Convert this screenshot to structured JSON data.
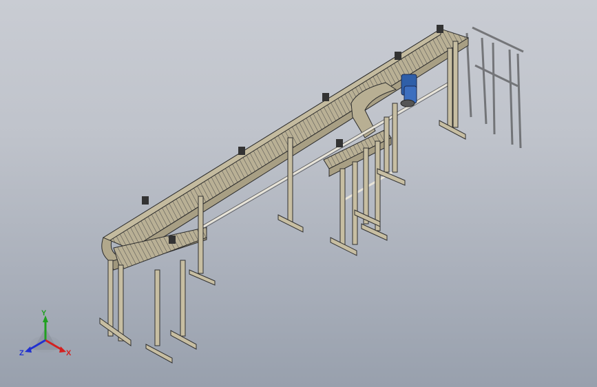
{
  "view": {
    "background_top": "#c9ccd3",
    "background_bottom": "#98a0ad",
    "frame_color": "#b8ad90",
    "frame_edge": "#3a3a3a",
    "motor_color": "#2f5fa8"
  },
  "triad": {
    "x_label": "X",
    "y_label": "Y",
    "z_label": "Z",
    "x_color": "#d42020",
    "y_color": "#20a020",
    "z_color": "#2030d0"
  }
}
